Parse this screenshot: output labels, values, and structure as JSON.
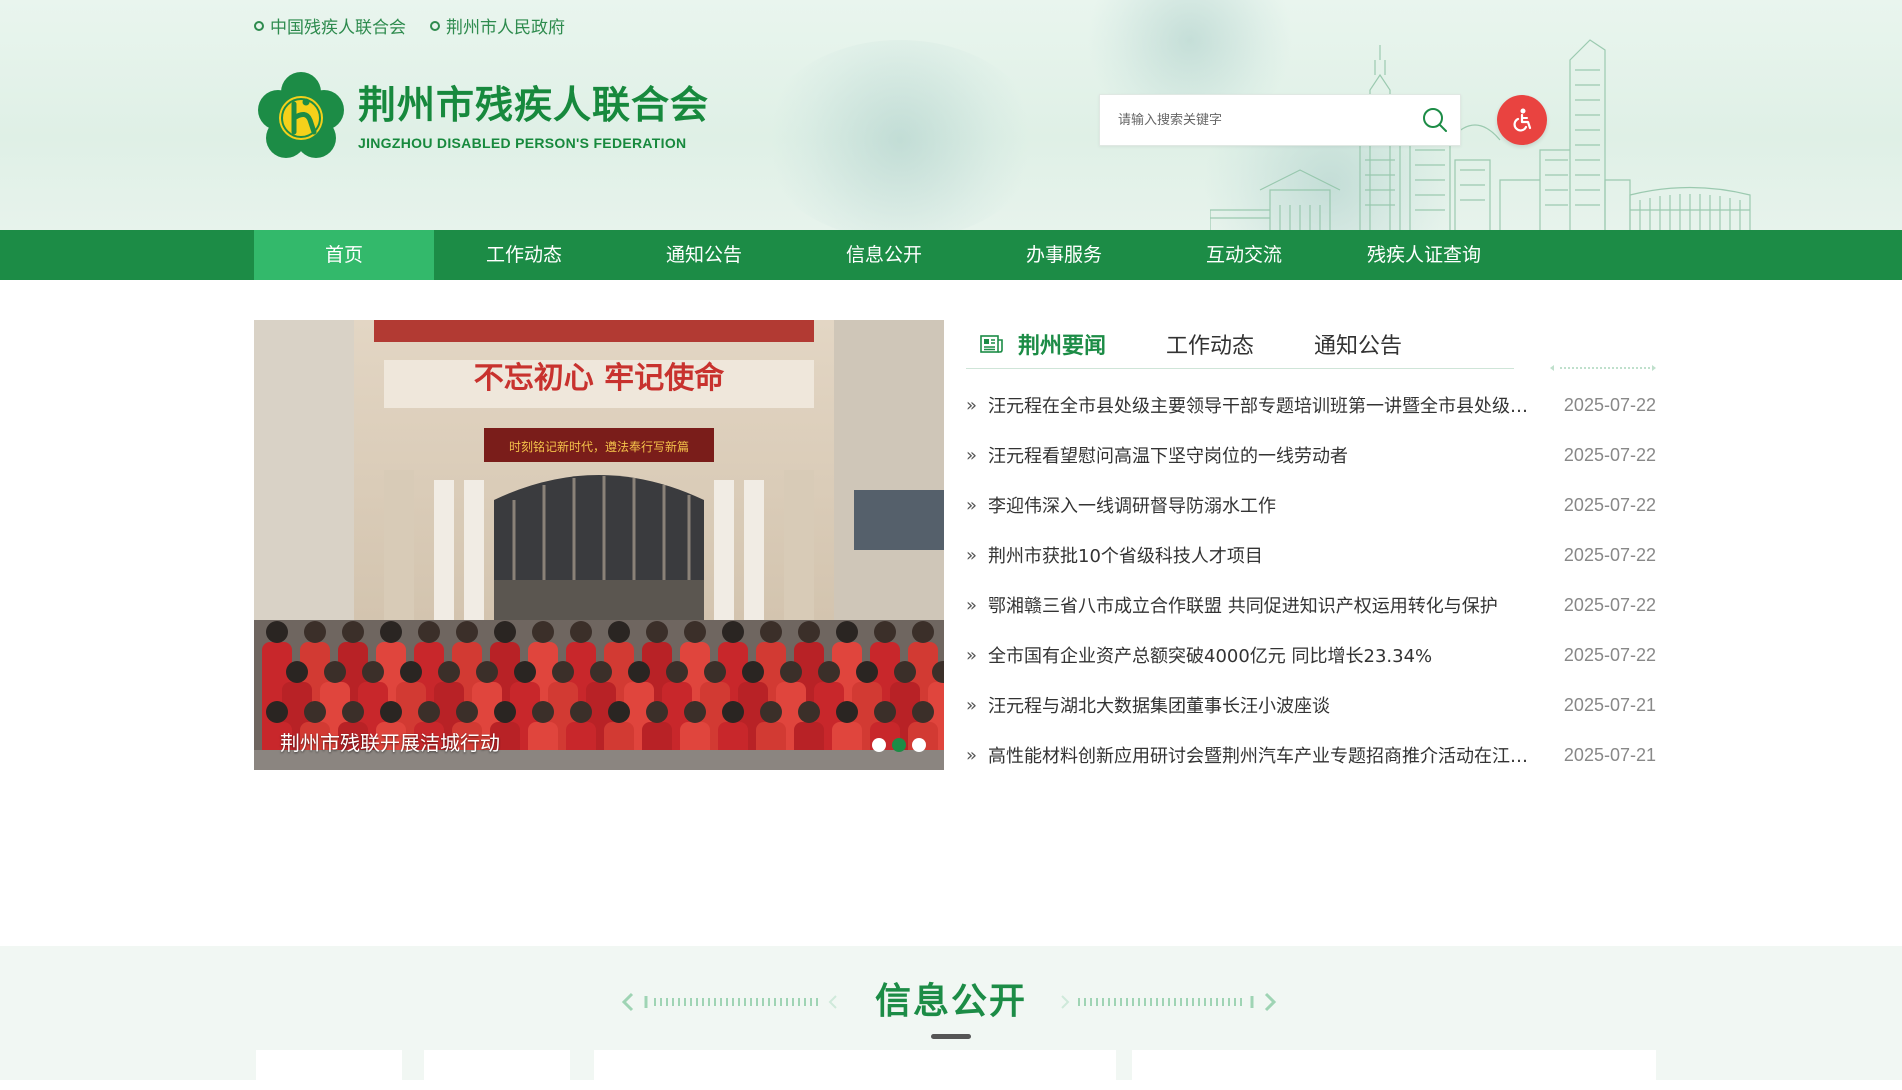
{
  "top_links": [
    "中国残疾人联合会",
    "荆州市人民政府"
  ],
  "logo": {
    "cn": "荆州市残疾人联合会",
    "en": "JINGZHOU DISABLED PERSON'S FEDERATION"
  },
  "search": {
    "placeholder": "请输入搜索关键字",
    "value": ""
  },
  "icons": {
    "search": "search-icon",
    "accessibility": "wheelchair-icon",
    "news_tab": "newspaper-icon",
    "list_bullet": "double-chevron-right-icon"
  },
  "nav": {
    "items": [
      "首页",
      "工作动态",
      "通知公告",
      "信息公开",
      "办事服务",
      "互动交流",
      "残疾人证查询"
    ],
    "active_index": 0
  },
  "carousel": {
    "caption": "荆州市残联开展洁城行动",
    "banner_text": "不忘初心 牢记使命",
    "sign_text": "时刻铭记新时代，遵法奉行写新篇",
    "dot_count": 3,
    "active_dot": 1
  },
  "news": {
    "tabs": [
      "荆州要闻",
      "工作动态",
      "通知公告"
    ],
    "active_tab": 0,
    "items": [
      {
        "title": "汪元程在全市县处级主要领导干部专题培训班第一讲暨全市县处级领导干部学习贯彻习近平总书记考察湖北重要讲话精神读书班上作辅导报告",
        "date": "2025-07-22"
      },
      {
        "title": "汪元程看望慰问高温下坚守岗位的一线劳动者",
        "date": "2025-07-22"
      },
      {
        "title": "李迎伟深入一线调研督导防溺水工作",
        "date": "2025-07-22"
      },
      {
        "title": "荆州市获批10个省级科技人才项目",
        "date": "2025-07-22"
      },
      {
        "title": "鄂湘赣三省八市成立合作联盟 共同促进知识产权运用转化与保护",
        "date": "2025-07-22"
      },
      {
        "title": "全市国有企业资产总额突破4000亿元 同比增长23.34%",
        "date": "2025-07-22"
      },
      {
        "title": "汪元程与湖北大数据集团董事长汪小波座谈",
        "date": "2025-07-21"
      },
      {
        "title": "高性能材料创新应用研讨会暨荆州汽车产业专题招商推介活动在江苏举行",
        "date": "2025-07-21"
      }
    ]
  },
  "info_section": {
    "title": "信息公开"
  },
  "colors": {
    "brand_green": "#1c8c46",
    "nav_active": "#33b96b",
    "accent_red": "#e94340",
    "section_bg": "#f1f7f3"
  }
}
